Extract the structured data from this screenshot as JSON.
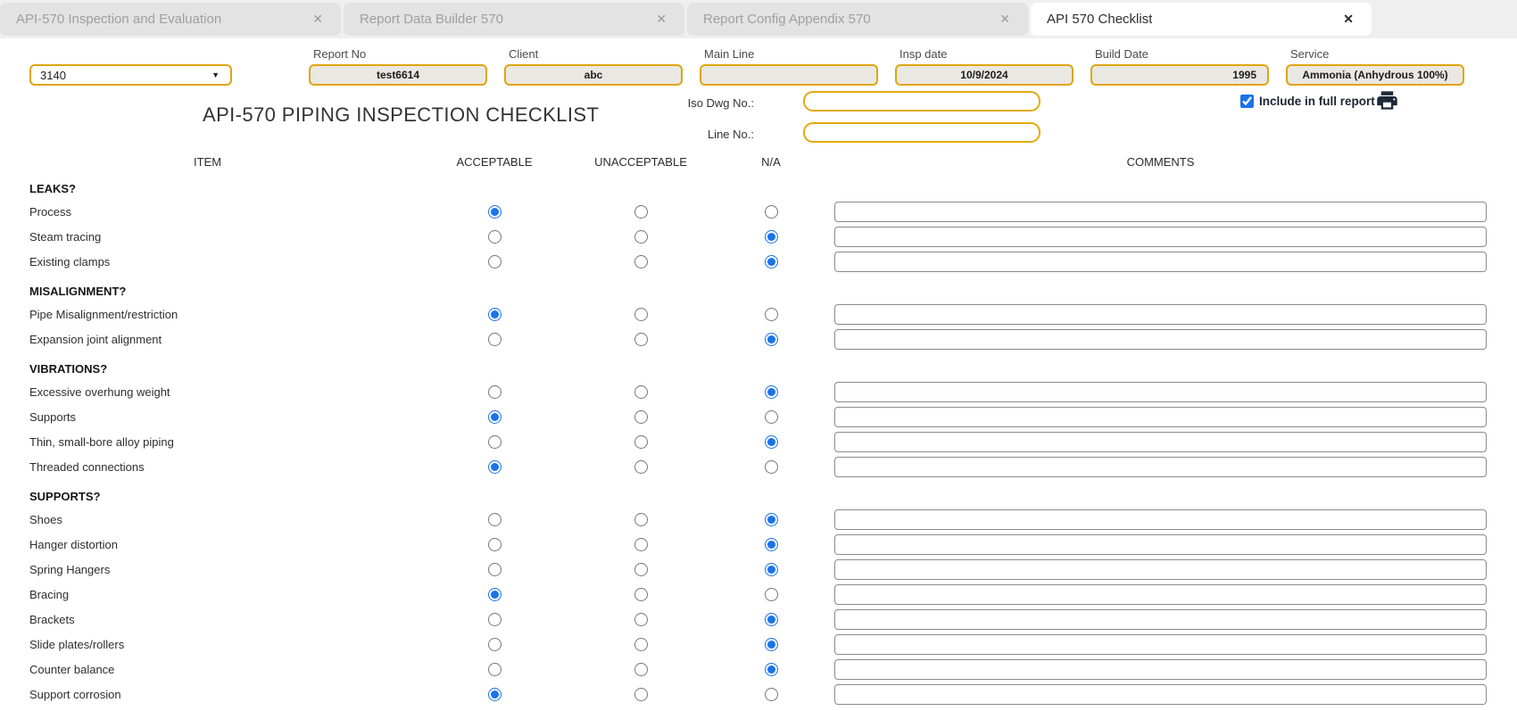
{
  "tabs": [
    {
      "label": "API-570 Inspection and Evaluation",
      "close_glyph": "✕",
      "active": false
    },
    {
      "label": "Report Data Builder 570",
      "close_glyph": "✕",
      "active": false
    },
    {
      "label": "Report Config Appendix 570",
      "close_glyph": "✕",
      "active": false
    },
    {
      "label": "API 570 Checklist",
      "close_glyph": "✕",
      "active": true
    }
  ],
  "header": {
    "line_select": {
      "value": "3140",
      "caret_icon": "caret-down-icon"
    },
    "fields": [
      {
        "label": "Report No",
        "value": "test6614",
        "align": "center"
      },
      {
        "label": "Client",
        "value": "abc",
        "align": "center"
      },
      {
        "label": "Main Line",
        "value": "",
        "align": "center"
      },
      {
        "label": "Insp date",
        "value": "10/9/2024",
        "align": "center"
      },
      {
        "label": "Build Date",
        "value": "1995",
        "align": "right"
      },
      {
        "label": "Service",
        "value": "Ammonia (Anhydrous 100%)",
        "align": "center"
      }
    ]
  },
  "title": "API-570 PIPING INSPECTION CHECKLIST",
  "meta": {
    "iso_dwg_label": "Iso Dwg No.:",
    "iso_dwg_value": "",
    "line_no_label": "Line No.:",
    "line_no_value": "",
    "include_label": "Include in full report",
    "include_checked": true,
    "printer_icon": "printer-icon"
  },
  "table": {
    "headers": {
      "item": "ITEM",
      "acceptable": "ACCEPTABLE",
      "unacceptable": "UNACCEPTABLE",
      "na": "N/A",
      "comments": "COMMENTS"
    },
    "sections": [
      {
        "title": "LEAKS?",
        "rows": [
          {
            "item": "Process",
            "status": "acceptable",
            "comment": ""
          },
          {
            "item": "Steam tracing",
            "status": "na",
            "comment": ""
          },
          {
            "item": "Existing clamps",
            "status": "na",
            "comment": ""
          }
        ]
      },
      {
        "title": "MISALIGNMENT?",
        "rows": [
          {
            "item": "Pipe Misalignment/restriction",
            "status": "acceptable",
            "comment": ""
          },
          {
            "item": "Expansion joint alignment",
            "status": "na",
            "comment": ""
          }
        ]
      },
      {
        "title": "VIBRATIONS?",
        "rows": [
          {
            "item": "Excessive overhung weight",
            "status": "na",
            "comment": ""
          },
          {
            "item": "Supports",
            "status": "acceptable",
            "comment": ""
          },
          {
            "item": "Thin, small-bore alloy piping",
            "status": "na",
            "comment": ""
          },
          {
            "item": "Threaded connections",
            "status": "acceptable",
            "comment": ""
          }
        ]
      },
      {
        "title": "SUPPORTS?",
        "rows": [
          {
            "item": "Shoes",
            "status": "na",
            "comment": ""
          },
          {
            "item": "Hanger distortion",
            "status": "na",
            "comment": ""
          },
          {
            "item": "Spring Hangers",
            "status": "na",
            "comment": ""
          },
          {
            "item": "Bracing",
            "status": "acceptable",
            "comment": ""
          },
          {
            "item": "Brackets",
            "status": "na",
            "comment": ""
          },
          {
            "item": "Slide plates/rollers",
            "status": "na",
            "comment": ""
          },
          {
            "item": "Counter balance",
            "status": "na",
            "comment": ""
          },
          {
            "item": "Support corrosion",
            "status": "acceptable",
            "comment": ""
          }
        ]
      }
    ]
  },
  "colors": {
    "accent_gold": "#e0a511",
    "field_beige": "#eae8e2",
    "radio_blue": "#1a73e8",
    "tab_gray": "#e3e3e3",
    "printer_navy": "#1d2838"
  }
}
